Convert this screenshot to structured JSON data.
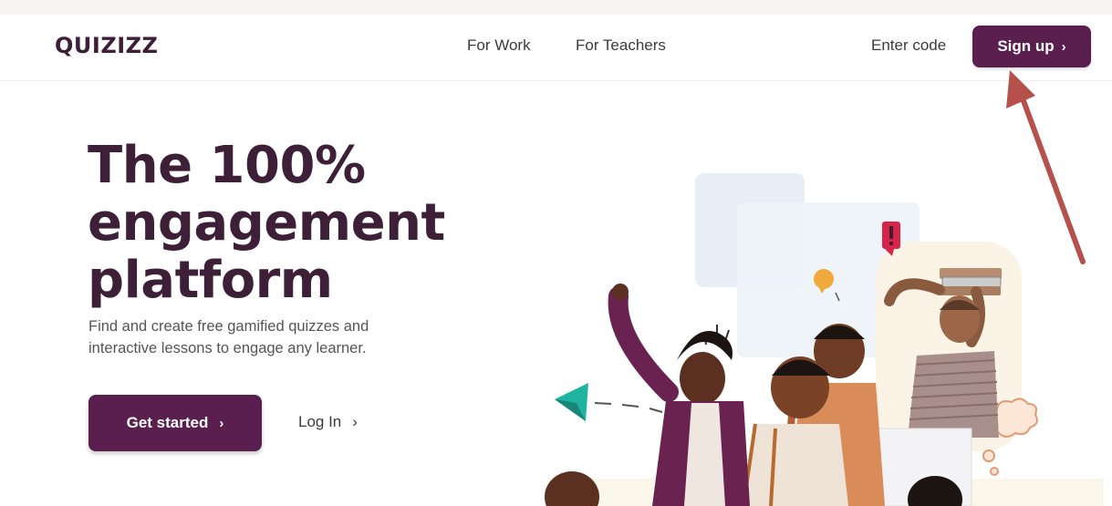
{
  "brand": {
    "logo_text": "QUIZIZZ"
  },
  "nav": {
    "links": [
      "For Work",
      "For Teachers"
    ],
    "enter_code": "Enter code",
    "signup": "Sign up",
    "chevron": "›"
  },
  "hero": {
    "title_lines": [
      "The 100%",
      "engagement",
      "platform"
    ],
    "subtitle_lines": [
      "Find and create free gamified quizzes and",
      "interactive lessons to engage any learner."
    ],
    "get_started": "Get started",
    "login": "Log In",
    "chevron": "›"
  },
  "colors": {
    "brand_purple": "#5a1e4f",
    "title": "#3d1f38",
    "annotation_arrow": "#b5504a",
    "teal": "#20b3a2",
    "alert_red": "#d62548"
  },
  "icons": [
    "chevron-right-icon",
    "paper-plane-icon",
    "exclamation-icon",
    "lightbulb-icon",
    "thought-cloud-icon"
  ]
}
